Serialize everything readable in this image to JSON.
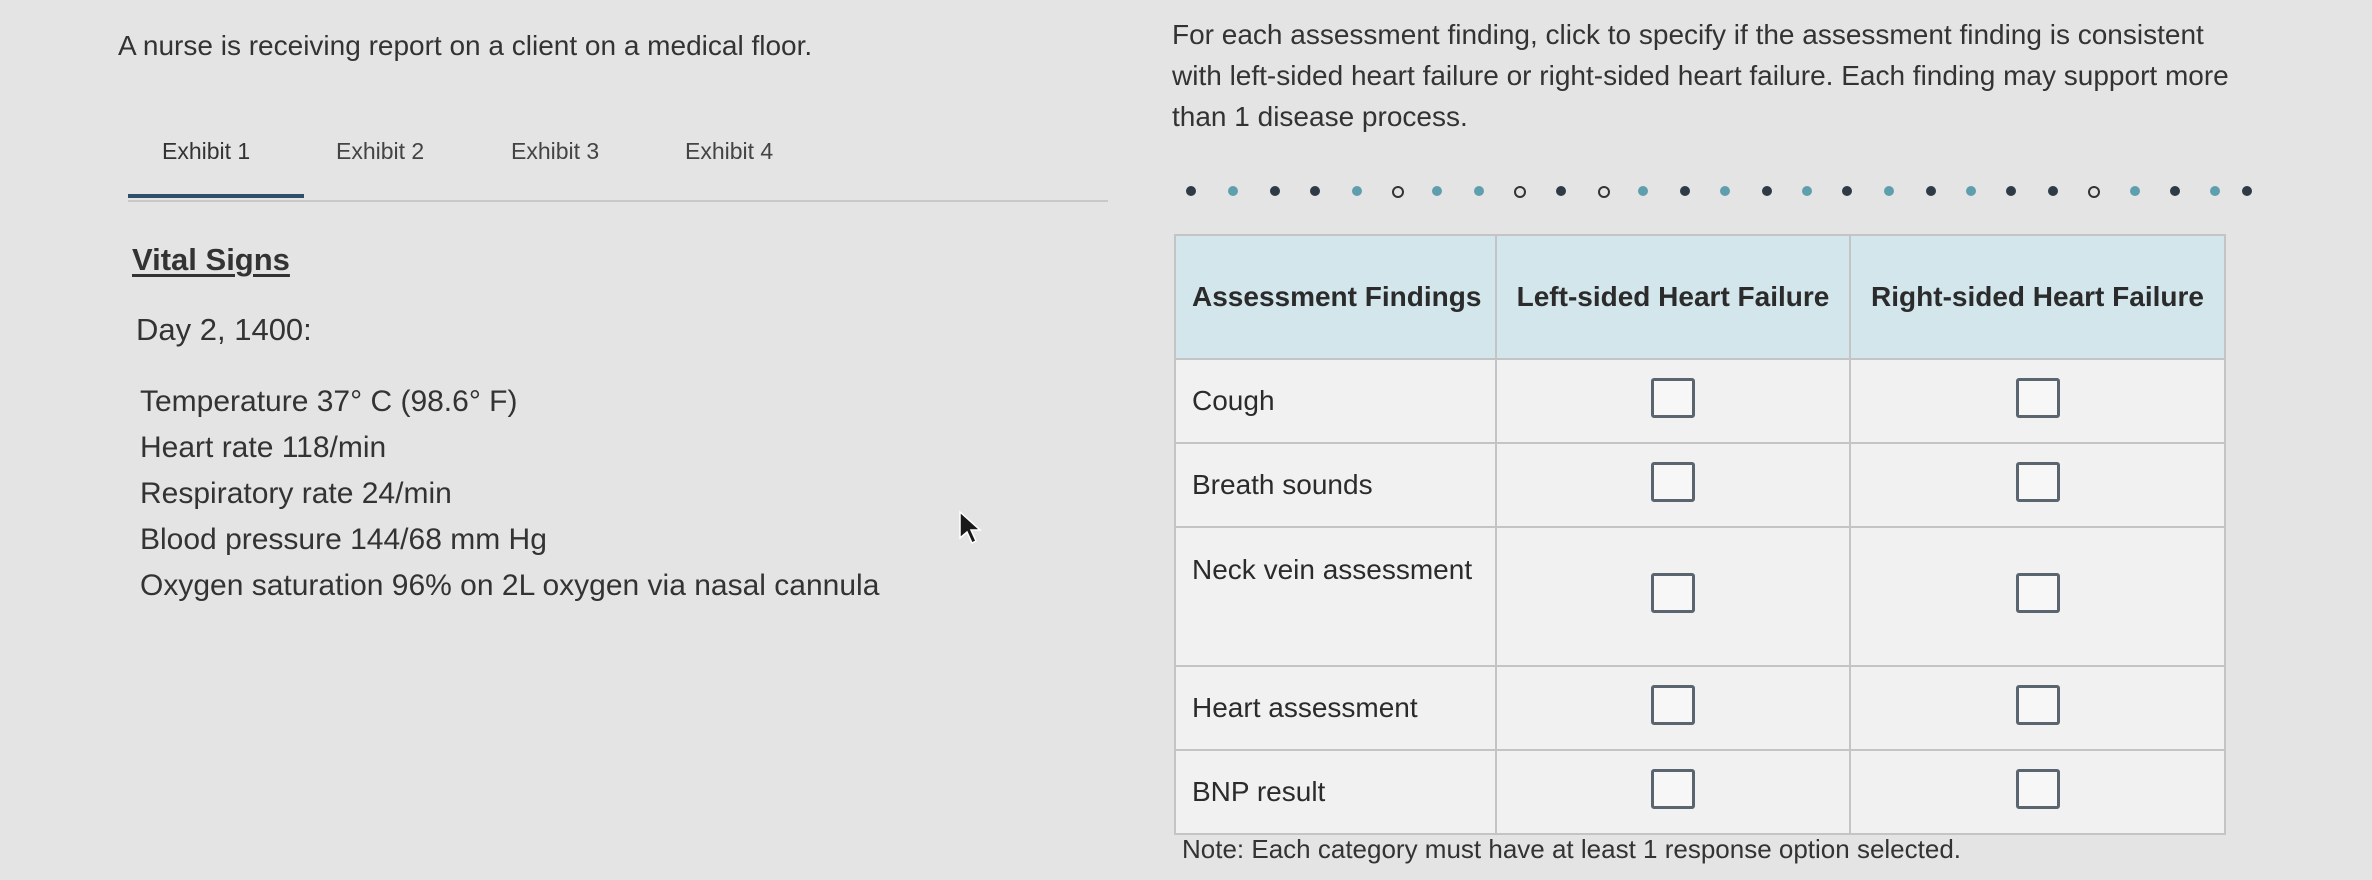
{
  "intro": "A nurse is receiving report on a client on a medical floor.",
  "tabs": [
    {
      "label": "Exhibit 1"
    },
    {
      "label": "Exhibit 2"
    },
    {
      "label": "Exhibit 3"
    },
    {
      "label": "Exhibit 4"
    }
  ],
  "active_tab": "Exhibit 1",
  "vitals": {
    "title": "Vital Signs",
    "subtitle": "Day 2, 1400:",
    "items": [
      "Temperature 37° C (98.6° F)",
      "Heart rate 118/min",
      "Respiratory rate 24/min",
      "Blood pressure 144/68 mm Hg",
      "Oxygen saturation 96% on 2L oxygen via nasal cannula"
    ]
  },
  "instructions": "For each assessment finding, click to specify if the assessment finding is consistent with left-sided heart failure or right-sided heart failure. Each finding may support more than 1 disease process.",
  "table": {
    "headers": {
      "findings": "Assessment Findings",
      "left": "Left-sided Heart Failure",
      "right": "Right-sided Heart Failure"
    },
    "rows": [
      {
        "finding": "Cough",
        "left_checked": false,
        "right_checked": false
      },
      {
        "finding": "Breath sounds",
        "left_checked": false,
        "right_checked": false
      },
      {
        "finding": "Neck vein assessment",
        "left_checked": false,
        "right_checked": false
      },
      {
        "finding": "Heart assessment",
        "left_checked": false,
        "right_checked": false
      },
      {
        "finding": "BNP result",
        "left_checked": false,
        "right_checked": false
      }
    ]
  },
  "note": "Note: Each category must have at least 1 response option selected.",
  "colors": {
    "background": "#e4e4e4",
    "table_header": "#d2e6ec",
    "tab_underline": "#2f4e67"
  }
}
